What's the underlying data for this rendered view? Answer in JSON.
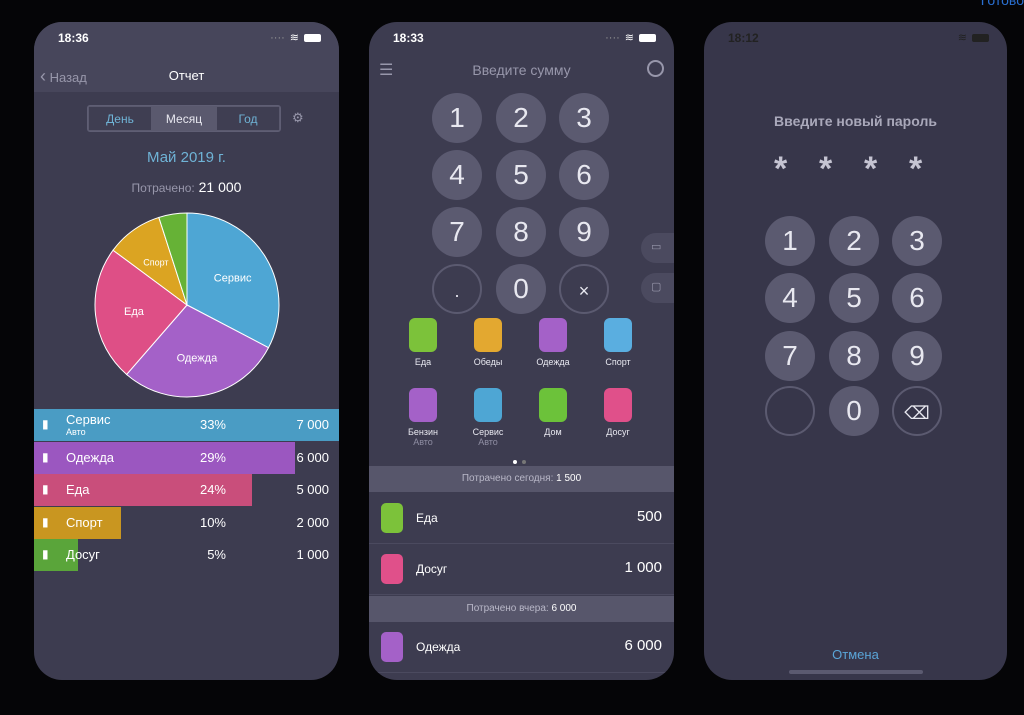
{
  "top_right_partial": "Готово",
  "report": {
    "time": "18:36",
    "back": "Назад",
    "title": "Отчет",
    "tabs": [
      "День",
      "Месяц",
      "Год"
    ],
    "active_tab": "Месяц",
    "period": "Май 2019 г.",
    "spent_label": "Потрачено:",
    "spent_value": "21 000",
    "chart_data": {
      "type": "pie",
      "slices": [
        {
          "label": "Сервис",
          "value": 33,
          "color": "#4ea6d4"
        },
        {
          "label": "Одежда",
          "value": 29,
          "color": "#a461c8"
        },
        {
          "label": "Еда",
          "value": 24,
          "color": "#de4f86"
        },
        {
          "label": "Спорт",
          "value": 10,
          "color": "#dba422"
        },
        {
          "label": "Досуг",
          "value": 5,
          "color": "#66b236"
        }
      ]
    },
    "rows": [
      {
        "label": "Сервис",
        "sub": "Авто",
        "percent": "33%",
        "amount": "7 000",
        "value": 7000,
        "color": "#4a9cc4",
        "icon": "car-icon"
      },
      {
        "label": "Одежда",
        "percent": "29%",
        "amount": "6 000",
        "value": 6000,
        "color": "#9b57c0",
        "icon": "pants-icon"
      },
      {
        "label": "Еда",
        "percent": "24%",
        "amount": "5 000",
        "value": 5000,
        "color": "#c94e7b",
        "icon": "food-icon"
      },
      {
        "label": "Спорт",
        "percent": "10%",
        "amount": "2 000",
        "value": 2000,
        "color": "#c99620",
        "icon": "dumbbell-icon"
      },
      {
        "label": "Досуг",
        "percent": "5%",
        "amount": "1 000",
        "value": 1000,
        "color": "#5aa53a",
        "icon": "bowling-icon"
      }
    ]
  },
  "entry": {
    "time": "18:33",
    "title": "Введите сумму",
    "keys": [
      "1",
      "2",
      "3",
      "4",
      "5",
      "6",
      "7",
      "8",
      "9",
      ".",
      "0",
      "×"
    ],
    "categories": [
      {
        "label": "Еда",
        "color": "#7cc23a"
      },
      {
        "label": "Обеды",
        "color": "#e3a830"
      },
      {
        "label": "Одежда",
        "color": "#a461c8"
      },
      {
        "label": "Спорт",
        "color": "#5aaee0"
      },
      {
        "label": "Бензин",
        "sub": "Авто",
        "color": "#a461c8"
      },
      {
        "label": "Сервис",
        "sub": "Авто",
        "color": "#4ea6d4"
      },
      {
        "label": "Дом",
        "color": "#6cc23a"
      },
      {
        "label": "Досуг",
        "color": "#e0508a"
      }
    ],
    "today_label": "Потрачено сегодня:",
    "today_value": "1 500",
    "yesterday_label": "Потрачено вчера:",
    "yesterday_value": "6 000",
    "today_items": [
      {
        "label": "Еда",
        "amount": "500",
        "color": "#7cc23a"
      },
      {
        "label": "Досуг",
        "amount": "1 000",
        "color": "#e0508a"
      }
    ],
    "yesterday_items": [
      {
        "label": "Одежда",
        "amount": "6 000",
        "color": "#a461c8"
      }
    ]
  },
  "passcode": {
    "time": "18:12",
    "title": "Введите новый пароль",
    "mask": [
      "*",
      "*",
      "*",
      "*"
    ],
    "keys": [
      "1",
      "2",
      "3",
      "4",
      "5",
      "6",
      "7",
      "8",
      "9",
      "",
      "0",
      "⌫"
    ],
    "cancel": "Отмена",
    "accent": "#5aa5d8"
  }
}
